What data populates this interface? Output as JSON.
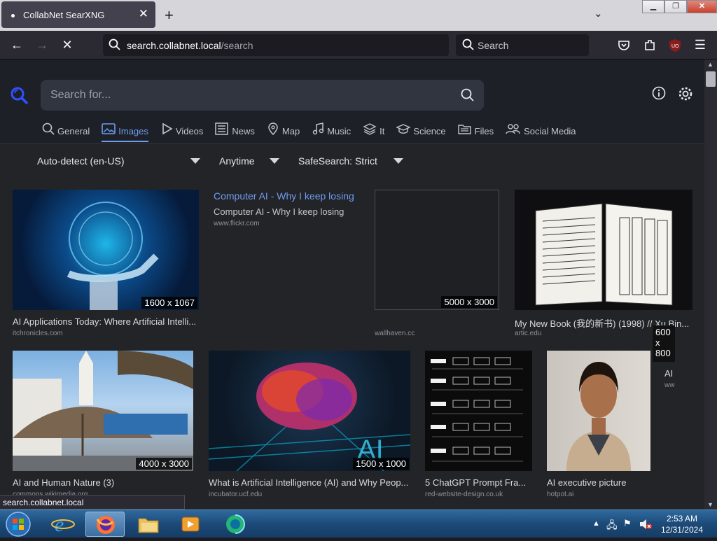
{
  "browser": {
    "tab_title": "CollabNet SearXNG",
    "url_host": "search.collabnet.local",
    "url_path": "/search",
    "search_placeholder": "Search",
    "status_text": "search.collabnet.local"
  },
  "searxng": {
    "query_placeholder": "Search for...",
    "categories": [
      {
        "label": "General",
        "icon": "search-icon"
      },
      {
        "label": "Images",
        "icon": "image-icon",
        "active": true
      },
      {
        "label": "Videos",
        "icon": "play-icon"
      },
      {
        "label": "News",
        "icon": "newspaper-icon"
      },
      {
        "label": "Map",
        "icon": "map-pin-icon"
      },
      {
        "label": "Music",
        "icon": "music-note-icon"
      },
      {
        "label": "It",
        "icon": "layers-icon"
      },
      {
        "label": "Science",
        "icon": "graduation-cap-icon"
      },
      {
        "label": "Files",
        "icon": "folder-icon"
      },
      {
        "label": "Social Media",
        "icon": "people-icon"
      }
    ],
    "filters": {
      "language": "Auto-detect (en-US)",
      "time": "Anytime",
      "safesearch": "SafeSearch: Strict"
    }
  },
  "results": [
    {
      "title": "AI Applications Today: Where Artificial Intelli...",
      "source": "itchronicles.com",
      "size": "1600 x 1067"
    },
    {
      "title": "Computer AI - Why I keep losing",
      "subtitle": "Computer AI - Why I keep losing",
      "source": "www.flickr.com"
    },
    {
      "title": "",
      "source": "wallhaven.cc",
      "size": "5000 x 3000"
    },
    {
      "title": "My New Book (我的新书) (1998) // Xu Bin...",
      "source": "artic.edu",
      "size_tooltip": [
        "600",
        "x",
        "800"
      ]
    },
    {
      "title": "AI",
      "source": "ww"
    },
    {
      "title": "AI and Human Nature (3)",
      "source": "commons.wikimedia.org",
      "size": "4000 x 3000"
    },
    {
      "title": "What is Artificial Intelligence (AI) and Why Peop...",
      "source": "incubator.ucf.edu",
      "size": "1500 x 1000"
    },
    {
      "title": "5 ChatGPT Prompt Fra...",
      "source": "red-website-design.co.uk"
    },
    {
      "title": "AI executive picture",
      "source": "hotpot.ai"
    }
  ],
  "taskbar": {
    "time": "2:53 AM",
    "date": "12/31/2024"
  },
  "colors": {
    "accent": "#6f9cf0",
    "page_bg": "#222428"
  }
}
